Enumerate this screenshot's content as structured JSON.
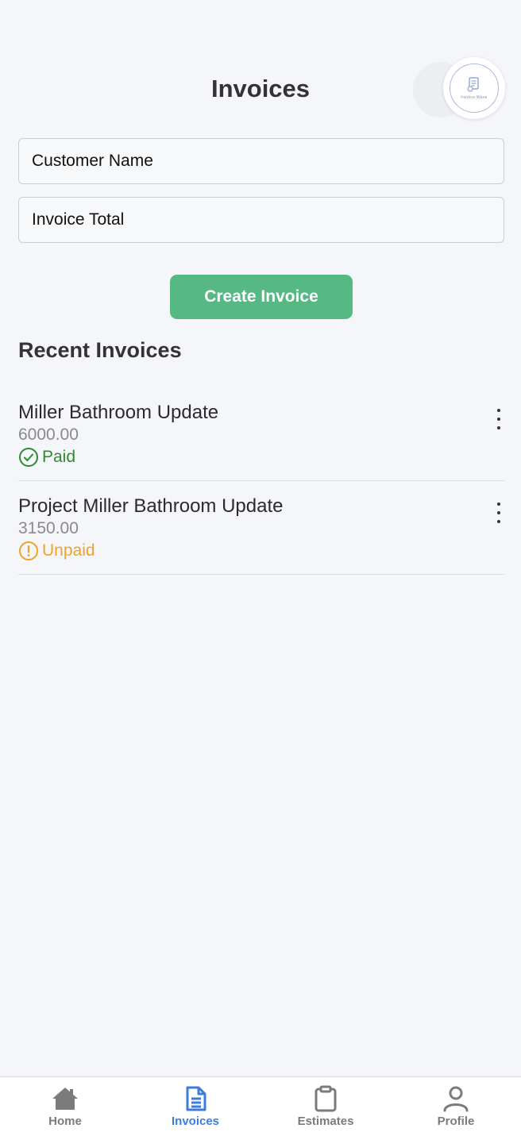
{
  "header": {
    "title": "Invoices",
    "avatar_icon": "invoice-logo-icon",
    "avatar_caption": "Invoice Wave"
  },
  "form": {
    "customer_name_placeholder": "Customer Name",
    "invoice_total_placeholder": "Invoice Total",
    "create_button_label": "Create Invoice",
    "create_button_color": "#56b883"
  },
  "recent": {
    "title": "Recent Invoices",
    "items": [
      {
        "title": "Miller Bathroom Update",
        "amount": "6000.00",
        "status": "Paid",
        "status_icon": "check-circle-icon",
        "status_color": "#2f8a2f"
      },
      {
        "title": "Project Miller Bathroom Update",
        "amount": "3150.00",
        "status": "Unpaid",
        "status_icon": "alert-circle-icon",
        "status_color": "#f0a12a"
      }
    ]
  },
  "tabbar": {
    "active_color": "#3b7ddd",
    "tabs": [
      {
        "label": "Home",
        "icon": "home-icon",
        "active": false
      },
      {
        "label": "Invoices",
        "icon": "document-icon",
        "active": true
      },
      {
        "label": "Estimates",
        "icon": "clipboard-icon",
        "active": false
      },
      {
        "label": "Profile",
        "icon": "person-icon",
        "active": false
      }
    ]
  }
}
